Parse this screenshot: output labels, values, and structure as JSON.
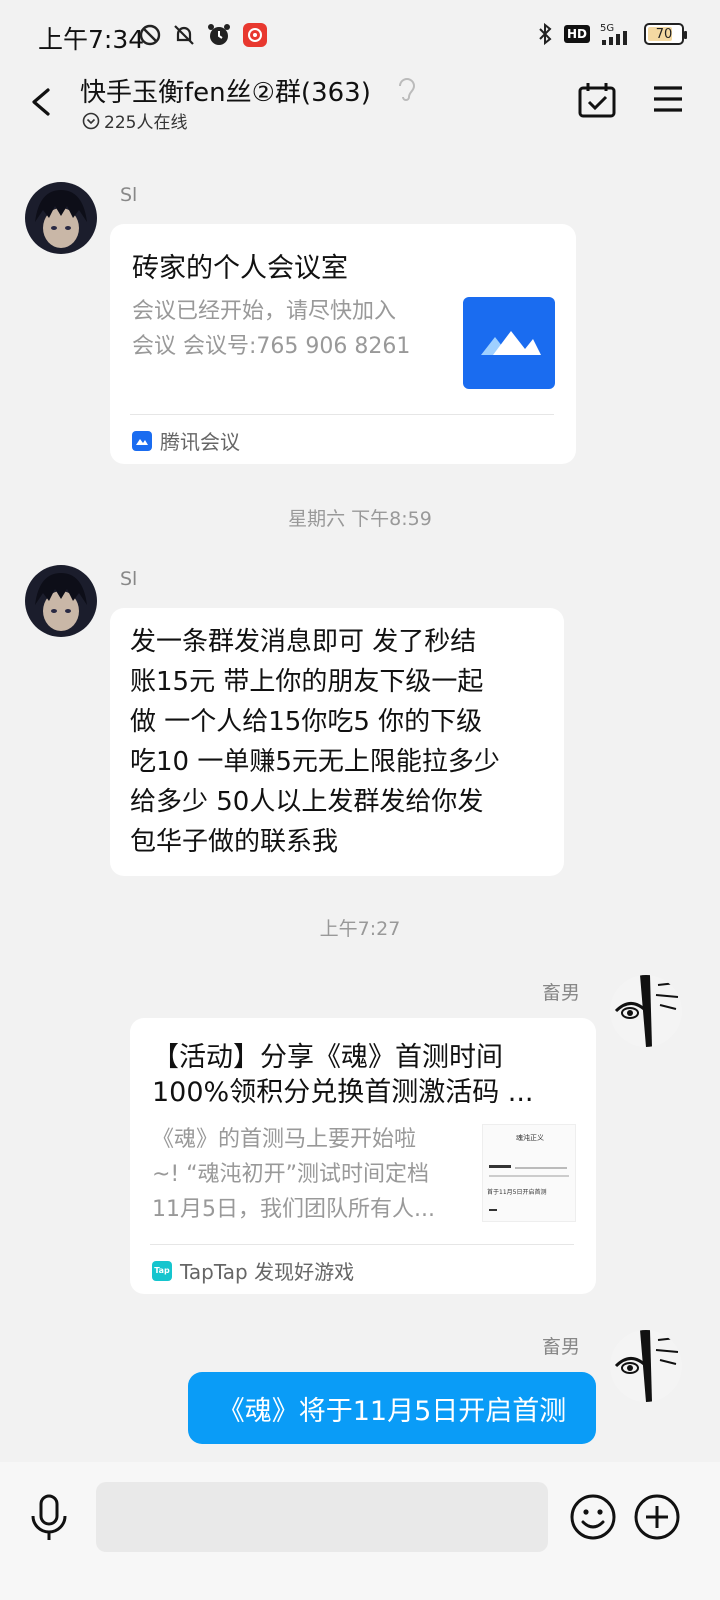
{
  "status_bar": {
    "time": "上午7:34",
    "battery": "70",
    "network": "5G",
    "hd": "HD"
  },
  "header": {
    "title": "快手玉衡fen丝②群(363)",
    "online": "225人在线"
  },
  "messages": [
    {
      "sender": "Sl",
      "card": {
        "title": "砖家的个人会议室",
        "desc_line1": "会议已经开始，请尽快加入",
        "desc_line2": "会议 会议号:765 906 8261",
        "source": "腾讯会议"
      }
    },
    {
      "timestamp": "星期六 下午8:59"
    },
    {
      "sender": "Sl",
      "text_lines": [
        "发一条群发消息即可 发了秒结",
        "账15元 带上你的朋友下级一起",
        "做 一个人给15你吃5 你的下级",
        "吃10 一单赚5元无上限能拉多少",
        "给多少 50人以上发群发给你发",
        "包华子做的联系我"
      ]
    },
    {
      "timestamp": "上午7:27"
    },
    {
      "sender": "畜男",
      "card": {
        "title_line1": "【活动】分享《魂》首测时间",
        "title_line2": "100%领积分兑换首测激活码 ...",
        "desc_line1": "《魂》的首测马上要开始啦",
        "desc_line2": "~! “魂沌初开”测试时间定档",
        "desc_line3": "11月5日，我们团队所有人...",
        "thumb_title": "魂沌正义",
        "thumb_line": "首于11月5日开启首测",
        "source": "TapTap 发现好游戏",
        "source_icon": "Tap"
      }
    },
    {
      "sender": "畜男",
      "text": "《魂》将于11月5日开启首测"
    }
  ],
  "colors": {
    "accent": "#0a9cf7",
    "tencent_meeting": "#1a6cf0",
    "taptap": "#15c5ce"
  }
}
